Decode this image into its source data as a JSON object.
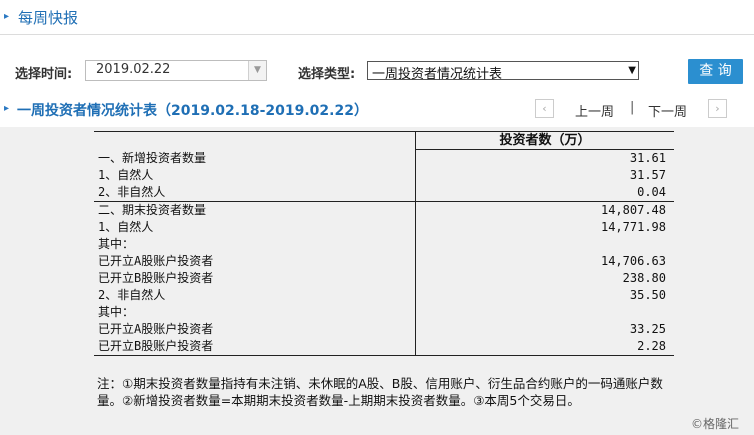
{
  "header": {
    "title": "每周快报"
  },
  "filters": {
    "time_label": "选择时间:",
    "time_value": "2019.02.22",
    "type_label": "选择类型:",
    "type_value": "一周投资者情况统计表",
    "query_label": "查 询"
  },
  "section": {
    "title": "一周投资者情况统计表（2019.02.18-2019.02.22）",
    "prev_label": "上一周",
    "separator": "|",
    "next_label": "下一周"
  },
  "table": {
    "column_header": "投资者数（万）",
    "rows": [
      {
        "label": "一、新增投资者数量",
        "value": "31.61"
      },
      {
        "label": "1、自然人",
        "value": "31.57"
      },
      {
        "label": "2、非自然人",
        "value": "0.04"
      },
      {
        "label": "二、期末投资者数量",
        "value": "14,807.48"
      },
      {
        "label": "1、自然人",
        "value": "14,771.98"
      },
      {
        "label": "其中：",
        "value": ""
      },
      {
        "label": "已开立A股账户投资者",
        "value": "14,706.63"
      },
      {
        "label": "已开立B股账户投资者",
        "value": "238.80"
      },
      {
        "label": "2、非自然人",
        "value": "35.50"
      },
      {
        "label": "其中：",
        "value": ""
      },
      {
        "label": "已开立A股账户投资者",
        "value": "33.25"
      },
      {
        "label": "已开立B股账户投资者",
        "value": "2.28"
      }
    ]
  },
  "note": "注：①期末投资者数量指持有未注销、未休眠的A股、B股、信用账户、衍生品合约账户的一码通账户数量。②新增投资者数量=本期期末投资者数量-上期期末投资者数量。③本周5个交易日。",
  "watermark": "©格隆汇"
}
